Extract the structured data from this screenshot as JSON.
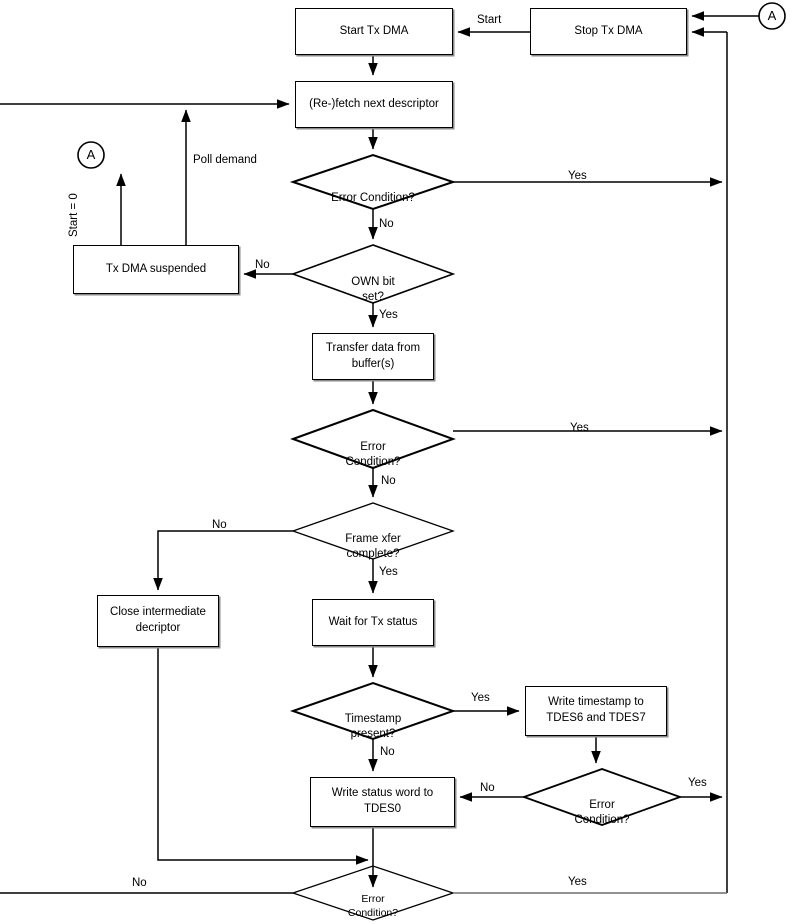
{
  "diagram": {
    "title": "Tx DMA Operation Flow",
    "colors": {
      "stroke": "#000000",
      "fill": "#ffffff",
      "shadow": "#8a8a8a"
    },
    "nodes": {
      "start_tx_dma": {
        "label": "Start Tx DMA"
      },
      "stop_tx_dma": {
        "label": "Stop Tx DMA"
      },
      "refetch_descriptor": {
        "label": "(Re-)fetch next descriptor"
      },
      "tx_dma_suspended": {
        "label": "Tx DMA suspended"
      },
      "transfer_data": {
        "label": "Transfer data from\nbuffer(s)"
      },
      "close_intermediate": {
        "label": "Close intermediate\ndecriptor"
      },
      "wait_tx_status": {
        "label": "Wait for Tx status"
      },
      "write_timestamp": {
        "label": "Write timestamp to\nTDES6 and TDES7"
      },
      "write_status_word": {
        "label": "Write status word to\nTDES0"
      },
      "error_condition_1": {
        "label": "Error Condition?"
      },
      "own_bit_set": {
        "label": "OWN bit\nset?"
      },
      "error_condition_2": {
        "label": "Error\nCondition?"
      },
      "frame_xfer_complete": {
        "label": "Frame xfer\ncomplete?"
      },
      "timestamp_present": {
        "label": "Timestamp\npresent?"
      },
      "error_condition_3": {
        "label": "Error\nCondition?"
      },
      "error_condition_4": {
        "label": "Error\nCondition?"
      },
      "connector_a_top": {
        "label": "A"
      },
      "connector_a_left": {
        "label": "A"
      }
    },
    "edge_labels": {
      "start": "Start",
      "err1_yes": "Yes",
      "err1_no": "No",
      "own_no": "No",
      "own_yes": "Yes",
      "err2_yes": "Yes",
      "err2_no": "No",
      "frame_no": "No",
      "frame_yes": "Yes",
      "timestamp_yes": "Yes",
      "timestamp_no": "No",
      "err3_no": "No",
      "err3_yes": "Yes",
      "err4_no": "No",
      "err4_yes": "Yes",
      "poll_demand": "Poll demand",
      "start_zero": "Start = 0"
    }
  }
}
